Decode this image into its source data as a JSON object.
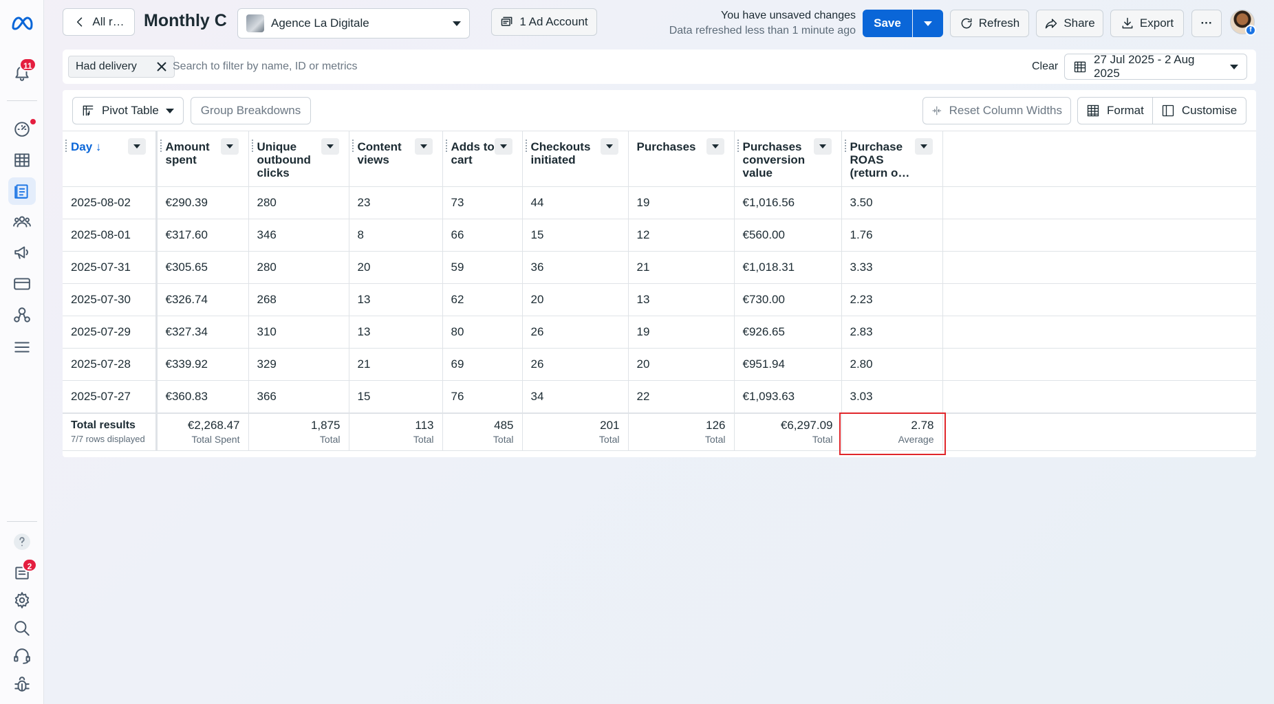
{
  "header": {
    "back_label": "All r…",
    "title": "Monthly Cc",
    "account_name": "Agence La Digitale",
    "ad_account_label": "1 Ad Account",
    "unsaved_title": "You have unsaved changes",
    "unsaved_sub": "Data refreshed less than 1 minute ago",
    "save_label": "Save",
    "refresh_label": "Refresh",
    "share_label": "Share",
    "export_label": "Export",
    "more_label": "···"
  },
  "rail": {
    "notifications_badge": "11",
    "bottom_badge": "2",
    "icons": [
      "meta-logo-icon",
      "bell-icon",
      "dashboard-icon",
      "table-icon",
      "reports-icon",
      "audience-icon",
      "megaphone-icon",
      "billing-icon",
      "accounts-icon",
      "menu-icon",
      "help-icon",
      "pages-icon",
      "settings-icon",
      "search-icon",
      "support-icon",
      "bug-icon"
    ]
  },
  "filters": {
    "chip_label": "Had delivery",
    "search_placeholder": "Search to filter by name, ID or metrics",
    "clear_label": "Clear",
    "date_range": "27 Jul 2025 - 2 Aug 2025"
  },
  "toolbar": {
    "pivot_label": "Pivot Table",
    "group_breakdowns_label": "Group Breakdowns",
    "reset_widths_label": "Reset Column Widths",
    "format_label": "Format",
    "customise_label": "Customise"
  },
  "table": {
    "columns": [
      {
        "label": "Day ↓"
      },
      {
        "label": "Amount spent"
      },
      {
        "label": "Unique outbound clicks"
      },
      {
        "label": "Content views"
      },
      {
        "label": "Adds to cart"
      },
      {
        "label": "Checkouts initiated"
      },
      {
        "label": "Purchases"
      },
      {
        "label": "Purchases conversion value"
      },
      {
        "label": "Purchase ROAS (return o…"
      }
    ],
    "rows": [
      [
        "2025-08-02",
        "€290.39",
        "280",
        "23",
        "73",
        "44",
        "19",
        "€1,016.56",
        "3.50"
      ],
      [
        "2025-08-01",
        "€317.60",
        "346",
        "8",
        "66",
        "15",
        "12",
        "€560.00",
        "1.76"
      ],
      [
        "2025-07-31",
        "€305.65",
        "280",
        "20",
        "59",
        "36",
        "21",
        "€1,018.31",
        "3.33"
      ],
      [
        "2025-07-30",
        "€326.74",
        "268",
        "13",
        "62",
        "20",
        "13",
        "€730.00",
        "2.23"
      ],
      [
        "2025-07-29",
        "€327.34",
        "310",
        "13",
        "80",
        "26",
        "19",
        "€926.65",
        "2.83"
      ],
      [
        "2025-07-28",
        "€339.92",
        "329",
        "21",
        "69",
        "26",
        "20",
        "€951.94",
        "2.80"
      ],
      [
        "2025-07-27",
        "€360.83",
        "366",
        "15",
        "76",
        "34",
        "22",
        "€1,093.63",
        "3.03"
      ]
    ],
    "totals": {
      "label": "Total results",
      "sub": "7/7 rows displayed",
      "cells": [
        {
          "value": "€2,268.47",
          "note": "Total Spent"
        },
        {
          "value": "1,875",
          "note": "Total"
        },
        {
          "value": "113",
          "note": "Total"
        },
        {
          "value": "485",
          "note": "Total"
        },
        {
          "value": "201",
          "note": "Total"
        },
        {
          "value": "126",
          "note": "Total"
        },
        {
          "value": "€6,297.09",
          "note": "Total"
        },
        {
          "value": "2.78",
          "note": "Average"
        }
      ]
    }
  },
  "colors": {
    "accent": "#0a66d8",
    "badge": "#e41e3f",
    "highlight": "#e0262b"
  }
}
